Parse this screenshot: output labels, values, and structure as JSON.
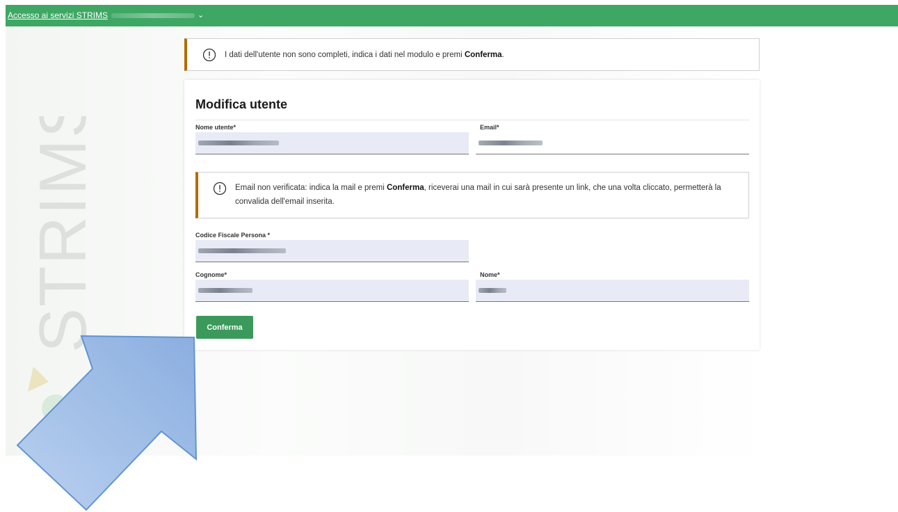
{
  "topbar": {
    "link_text": "Accesso ai servizi STRIMS",
    "chevron": "⌄"
  },
  "watermark": {
    "text": "STRIMS"
  },
  "top_alert": {
    "icon": "exclamation-circle-icon",
    "text_before": "I dati dell'utente non sono completi, indica i dati nel modulo e premi ",
    "text_bold": "Conferma",
    "text_after": "."
  },
  "form": {
    "title": "Modifica utente",
    "fields": {
      "username_label": "Nome utente*",
      "email_label": "Email*",
      "tax_code_label": "Codice Fiscale Persona *",
      "surname_label": "Cognome*",
      "name_label": "Nome*"
    },
    "email_alert": {
      "icon": "exclamation-circle-icon",
      "text_before": "Email non verificata: indica la mail e premi ",
      "text_bold": "Conferma",
      "text_after": ", riceverai una mail in cui sarà presente un link, che una volta cliccato, permetterà la convalida dell'email inserita."
    },
    "submit_label": "Conferma"
  },
  "colors": {
    "topbar": "#3ea764",
    "button": "#3b9a5b",
    "alert_accent": "#b36b00",
    "field_bg": "#e8eaf6",
    "arrow_fill": "#9dbde6",
    "arrow_stroke": "#5a8fd0"
  }
}
